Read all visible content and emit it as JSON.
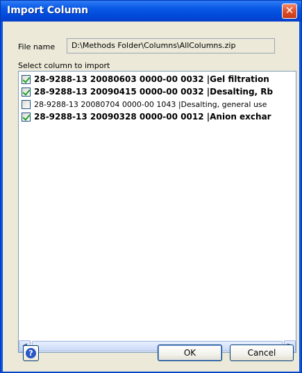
{
  "window": {
    "title": "Import Column",
    "close_glyph": "✕"
  },
  "file": {
    "label": "File name",
    "value": "D:\\Methods Folder\\Columns\\AllColumns.zip"
  },
  "select_label": "Select column to import",
  "columns": [
    {
      "text": "28-9288-13 20080603 0000-00 0032 |Gel filtration",
      "checked": true,
      "bold": true
    },
    {
      "text": "28-9288-13 20090415 0000-00 0032 |Desalting, Rb",
      "checked": true,
      "bold": true
    },
    {
      "text": "28-9288-13 20080704 0000-00 1043 |Desalting, general use",
      "checked": false,
      "bold": false
    },
    {
      "text": "28-9288-13 20090328 0000-00 0012 |Anion exchar",
      "checked": true,
      "bold": true
    }
  ],
  "scrollbar": {
    "left_icon": "◀",
    "right_icon": "▶"
  },
  "buttons": {
    "ok": "OK",
    "cancel": "Cancel",
    "help_icon": "?"
  },
  "colors": {
    "titlebar": "#0a54e0",
    "dialog_bg": "#ece9d8",
    "checkmark": "#21a121"
  }
}
